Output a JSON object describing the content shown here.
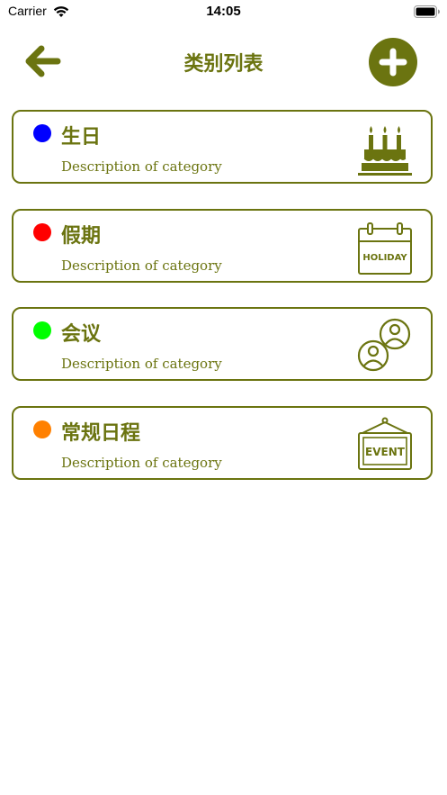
{
  "status_bar": {
    "carrier": "Carrier",
    "time": "14:05"
  },
  "nav": {
    "title": "类别列表",
    "back_icon": "arrow-left-icon",
    "add_icon": "plus-circle-icon"
  },
  "colors": {
    "accent": "#6b7410",
    "background": "#ffffff"
  },
  "categories": [
    {
      "title": "生日",
      "description": "Description of category",
      "dot_color": "#0000ff",
      "icon": "birthday-cake-icon"
    },
    {
      "title": "假期",
      "description": "Description of category",
      "dot_color": "#ff0000",
      "icon": "holiday-calendar-icon",
      "icon_text": "HOLIDAY"
    },
    {
      "title": "会议",
      "description": "Description of category",
      "dot_color": "#00ff00",
      "icon": "meeting-people-icon"
    },
    {
      "title": "常规日程",
      "description": "Description of category",
      "dot_color": "#ff8000",
      "icon": "event-sign-icon",
      "icon_text": "EVENT"
    }
  ]
}
